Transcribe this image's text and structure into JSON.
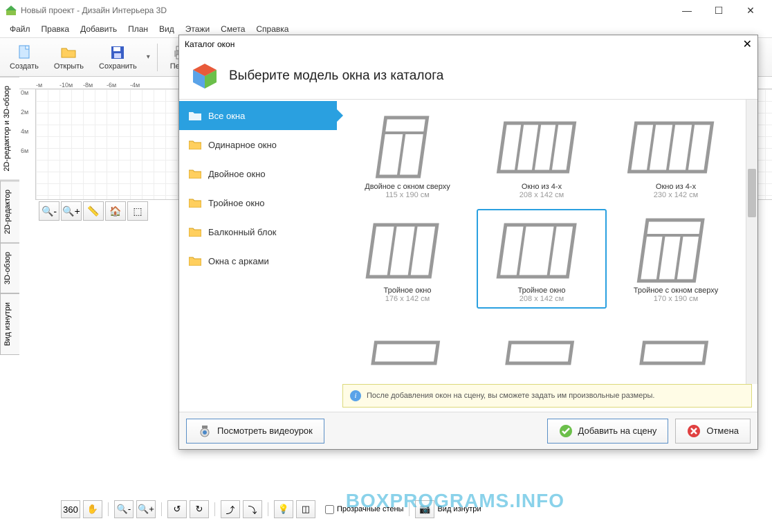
{
  "titlebar": {
    "title": "Новый проект - Дизайн Интерьера 3D"
  },
  "menu": [
    "Файл",
    "Правка",
    "Добавить",
    "План",
    "Вид",
    "Этажи",
    "Смета",
    "Справка"
  ],
  "toolbar": {
    "create": "Создать",
    "open": "Открыть",
    "save": "Сохранить",
    "print": "Печ..."
  },
  "vtabs": {
    "combo": "2D-редактор и 3D-обзор",
    "editor2d": "2D-редактор",
    "view3d": "3D-обзор",
    "inside": "Вид изнутри"
  },
  "ruler_h": [
    "-м",
    "-10м",
    "-8м",
    "-6м",
    "-4м"
  ],
  "ruler_v": [
    "0м",
    "2м",
    "4м",
    "6м"
  ],
  "bottom": {
    "transparent_walls": "Прозрачные стены",
    "view_inside": "Вид изнутри"
  },
  "watermark": "BOXPROGRAMS.INFO",
  "dialog": {
    "title": "Каталог окон",
    "heading": "Выберите модель окна из каталога",
    "categories": [
      {
        "label": "Все окна",
        "active": true
      },
      {
        "label": "Одинарное окно",
        "active": false
      },
      {
        "label": "Двойное окно",
        "active": false
      },
      {
        "label": "Тройное окно",
        "active": false
      },
      {
        "label": "Балконный блок",
        "active": false
      },
      {
        "label": "Окна с арками",
        "active": false
      }
    ],
    "items": [
      {
        "name": "Двойное с окном сверху",
        "dim": "115 x 190 см",
        "sel": false
      },
      {
        "name": "Окно из 4-х",
        "dim": "208 x 142 см",
        "sel": false
      },
      {
        "name": "Окно из 4-х",
        "dim": "230 x 142 см",
        "sel": false
      },
      {
        "name": "Тройное окно",
        "dim": "176 x 142 см",
        "sel": false
      },
      {
        "name": "Тройное окно",
        "dim": "208 x 142 см",
        "sel": true
      },
      {
        "name": "Тройное с окном сверху",
        "dim": "170 x 190 см",
        "sel": false
      }
    ],
    "hint": "После добавления окон на сцену, вы сможете задать им произвольные размеры.",
    "buttons": {
      "video": "Посмотреть видеоурок",
      "add": "Добавить на сцену",
      "cancel": "Отмена"
    }
  }
}
